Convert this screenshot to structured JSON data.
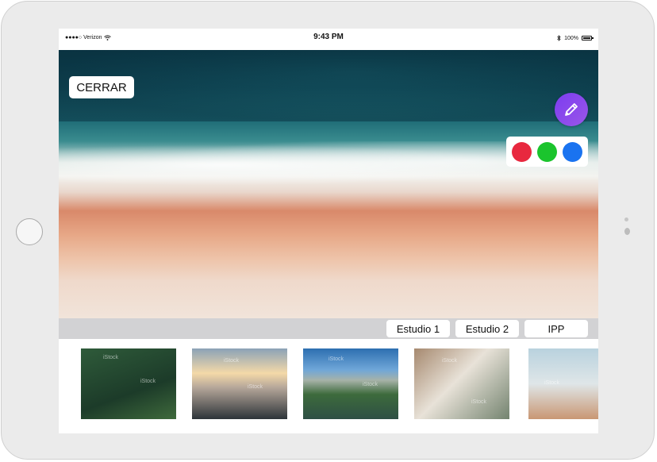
{
  "status_bar": {
    "carrier": "Verizon",
    "time": "9:43 PM",
    "battery": "100%"
  },
  "photo": {
    "close_label": "CERRAR",
    "icons": {
      "pen": "pencil-icon"
    }
  },
  "palette": {
    "colors": [
      "#e8283f",
      "#1bc42d",
      "#1a73f0"
    ]
  },
  "tabs": [
    {
      "label": "Estudio 1"
    },
    {
      "label": "Estudio 2"
    },
    {
      "label": "IPP"
    }
  ],
  "thumbnails": {
    "watermark": "iStock"
  },
  "colors": {
    "accent": "#8a4cef",
    "tab_strip": "#d2d2d4"
  }
}
